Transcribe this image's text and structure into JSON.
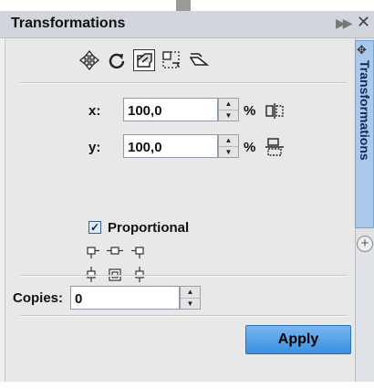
{
  "panel": {
    "title": "Transformations",
    "expand_icon": "double-chevron-right-icon",
    "close_icon": "close-icon"
  },
  "mode_buttons": [
    {
      "name": "position",
      "icon": "move-arrows-icon"
    },
    {
      "name": "rotate",
      "icon": "rotate-icon"
    },
    {
      "name": "scale-and-mirror",
      "icon": "scale-icon",
      "selected": true
    },
    {
      "name": "size",
      "icon": "size-icon"
    },
    {
      "name": "skew",
      "icon": "skew-icon"
    }
  ],
  "fields": {
    "x": {
      "label": "x:",
      "value": "100,0",
      "unit": "%"
    },
    "y": {
      "label": "y:",
      "value": "100,0",
      "unit": "%"
    }
  },
  "proportional": {
    "label": "Proportional",
    "checked": true
  },
  "copies": {
    "label": "Copies:",
    "value": "0"
  },
  "apply_label": "Apply",
  "side_tab": {
    "label": "Transformations",
    "icon": "transform-icon",
    "add_icon": "add-tab-icon"
  },
  "colors": {
    "apply_button": "#3b8fe0",
    "side_tab": "#a9c8ec",
    "titlebar": "#d2d6dc"
  }
}
